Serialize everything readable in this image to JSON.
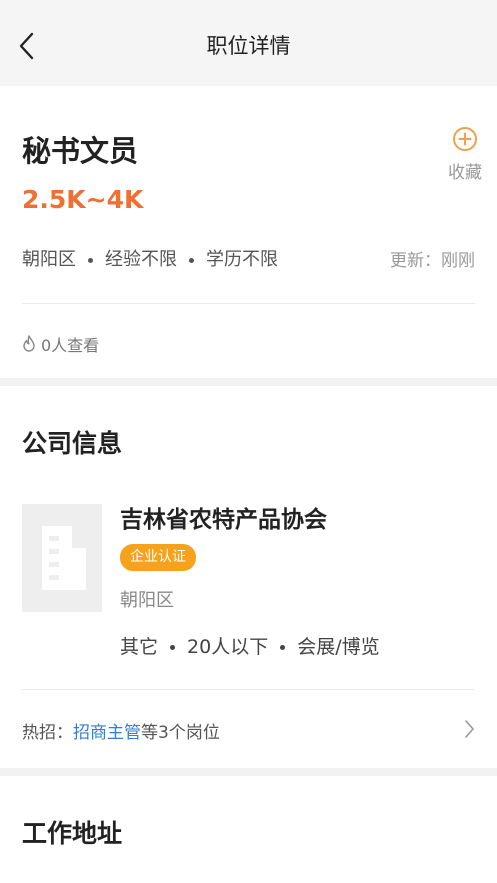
{
  "nav": {
    "title": "职位详情",
    "back_icon": "chevron-left-icon"
  },
  "job": {
    "title": "秘书文员",
    "salary": "2.5K~4K",
    "favorite_label": "收藏",
    "district": "朝阳区",
    "experience": "经验不限",
    "education": "学历不限",
    "updated": "更新：刚刚",
    "views": "0人查看"
  },
  "company": {
    "section_title": "公司信息",
    "name": "吉林省农特产品协会",
    "certification": "企业认证",
    "district": "朝阳区",
    "industry": "其它",
    "size": "20人以下",
    "category": "会展/博览",
    "hot_prefix": "热招：",
    "hot_position": "招商主管",
    "hot_suffix": "等3个岗位"
  },
  "address": {
    "section_title": "工作地址"
  },
  "colors": {
    "salary": "#f06f32",
    "badge": "#f7a21b",
    "link": "#2f7fd6",
    "fav_icon": "#f0a04b"
  }
}
